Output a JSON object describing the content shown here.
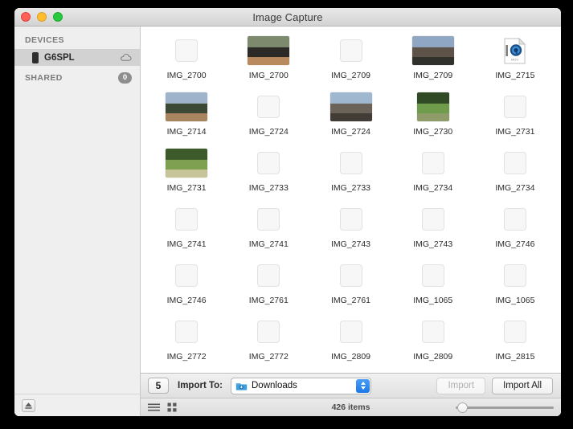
{
  "window": {
    "title": "Image Capture",
    "traffic_lights": [
      "close-button",
      "minimize-button",
      "maximize-button"
    ]
  },
  "sidebar": {
    "devices_header": "DEVICES",
    "devices": [
      {
        "label": "G6SPL",
        "selected": true,
        "icon": "phone-icon",
        "accessory_icon": "cloud-icon"
      }
    ],
    "shared_header": "SHARED",
    "shared_badge": "0",
    "eject_icon": "eject-icon"
  },
  "grid": {
    "rows": [
      [
        {
          "name": "IMG_2700",
          "type": "empty"
        },
        {
          "name": "IMG_2700",
          "type": "photo",
          "colors": [
            "#7e8a6e",
            "#2b2a26",
            "#b98a5d"
          ]
        },
        {
          "name": "IMG_2709",
          "type": "empty"
        },
        {
          "name": "IMG_2709",
          "type": "photo",
          "colors": [
            "#8fa7c2",
            "#5d5348",
            "#30302c"
          ]
        },
        {
          "name": "IMG_2715",
          "type": "movie"
        }
      ],
      [
        {
          "name": "IMG_2714",
          "type": "photo",
          "colors": [
            "#9fb4cb",
            "#3c4a35",
            "#a8855f"
          ]
        },
        {
          "name": "IMG_2724",
          "type": "empty"
        },
        {
          "name": "IMG_2724",
          "type": "photo",
          "colors": [
            "#9fb8cf",
            "#6b6258",
            "#423c37"
          ]
        },
        {
          "name": "IMG_2730",
          "type": "photo-tall",
          "colors": [
            "#2f4a24",
            "#6f9c4a",
            "#8f9c6a"
          ]
        },
        {
          "name": "IMG_2731",
          "type": "empty"
        }
      ],
      [
        {
          "name": "IMG_2731",
          "type": "photo",
          "colors": [
            "#3d5a2a",
            "#7ea050",
            "#c8c49a"
          ]
        },
        {
          "name": "IMG_2733",
          "type": "empty"
        },
        {
          "name": "IMG_2733",
          "type": "empty"
        },
        {
          "name": "IMG_2734",
          "type": "empty"
        },
        {
          "name": "IMG_2734",
          "type": "empty"
        }
      ],
      [
        {
          "name": "IMG_2741",
          "type": "empty"
        },
        {
          "name": "IMG_2741",
          "type": "empty"
        },
        {
          "name": "IMG_2743",
          "type": "empty"
        },
        {
          "name": "IMG_2743",
          "type": "empty"
        },
        {
          "name": "IMG_2746",
          "type": "empty"
        }
      ],
      [
        {
          "name": "IMG_2746",
          "type": "empty"
        },
        {
          "name": "IMG_2761",
          "type": "empty"
        },
        {
          "name": "IMG_2761",
          "type": "empty"
        },
        {
          "name": "IMG_1065",
          "type": "empty"
        },
        {
          "name": "IMG_1065",
          "type": "empty"
        }
      ],
      [
        {
          "name": "IMG_2772",
          "type": "empty"
        },
        {
          "name": "IMG_2772",
          "type": "empty"
        },
        {
          "name": "IMG_2809",
          "type": "empty"
        },
        {
          "name": "IMG_2809",
          "type": "empty"
        },
        {
          "name": "IMG_2815",
          "type": "empty"
        }
      ]
    ]
  },
  "import_bar": {
    "rotate_label": "5",
    "import_to_label": "Import To:",
    "destination": "Downloads",
    "destination_icon": "downloads-folder-icon",
    "import_label": "Import",
    "import_enabled": false,
    "import_all_label": "Import All"
  },
  "status_bar": {
    "list_view_icon": "list-view-icon",
    "icon_view_icon": "icon-view-icon",
    "item_count": "426 items",
    "zoom_slider_value": 4
  }
}
